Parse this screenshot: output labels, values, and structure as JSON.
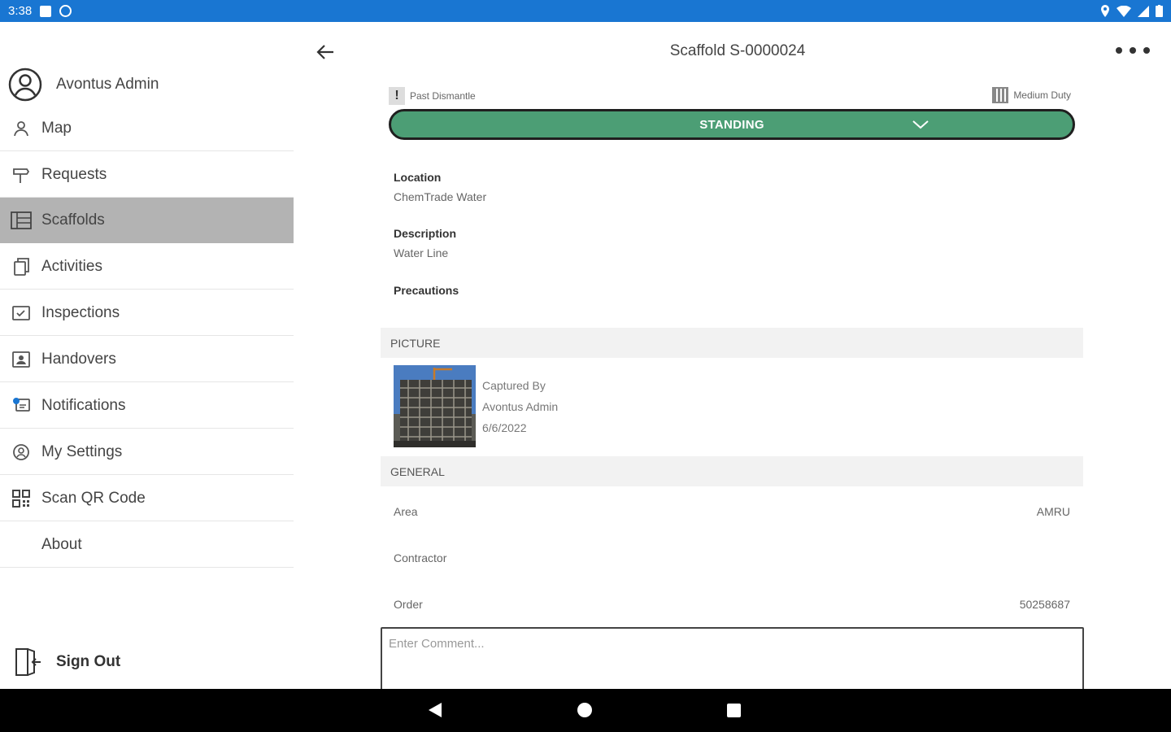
{
  "status_bar": {
    "time": "3:38"
  },
  "drawer": {
    "user_name": "Avontus Admin",
    "items": [
      {
        "label": "Map",
        "icon": "person-pin-icon"
      },
      {
        "label": "Requests",
        "icon": "signpost-icon"
      },
      {
        "label": "Scaffolds",
        "icon": "scaffold-icon",
        "selected": true
      },
      {
        "label": "Activities",
        "icon": "copy-icon"
      },
      {
        "label": "Inspections",
        "icon": "checklist-icon"
      },
      {
        "label": "Handovers",
        "icon": "handover-icon"
      },
      {
        "label": "Notifications",
        "icon": "notification-icon"
      },
      {
        "label": "My Settings",
        "icon": "user-settings-icon"
      },
      {
        "label": "Scan QR Code",
        "icon": "qr-code-icon"
      },
      {
        "label": "About",
        "icon": ""
      }
    ],
    "sign_out_label": "Sign Out"
  },
  "header": {
    "title": "Scaffold S-0000024"
  },
  "tags": {
    "left": "Past Dismantle",
    "right": "Medium Duty"
  },
  "status": {
    "label": "STANDING",
    "color": "#4c9e75"
  },
  "fields": {
    "location_label": "Location",
    "location_value": "ChemTrade Water",
    "description_label": "Description",
    "description_value": "Water Line",
    "precautions_label": "Precautions"
  },
  "picture": {
    "section_title": "PICTURE",
    "captured_by_label": "Captured By",
    "captured_by": "Avontus Admin",
    "date": "6/6/2022"
  },
  "general": {
    "section_title": "GENERAL",
    "rows": [
      {
        "label": "Area",
        "value": "AMRU"
      },
      {
        "label": "Contractor",
        "value": ""
      },
      {
        "label": "Order",
        "value": "50258687"
      }
    ]
  },
  "comment": {
    "placeholder": "Enter Comment..."
  }
}
